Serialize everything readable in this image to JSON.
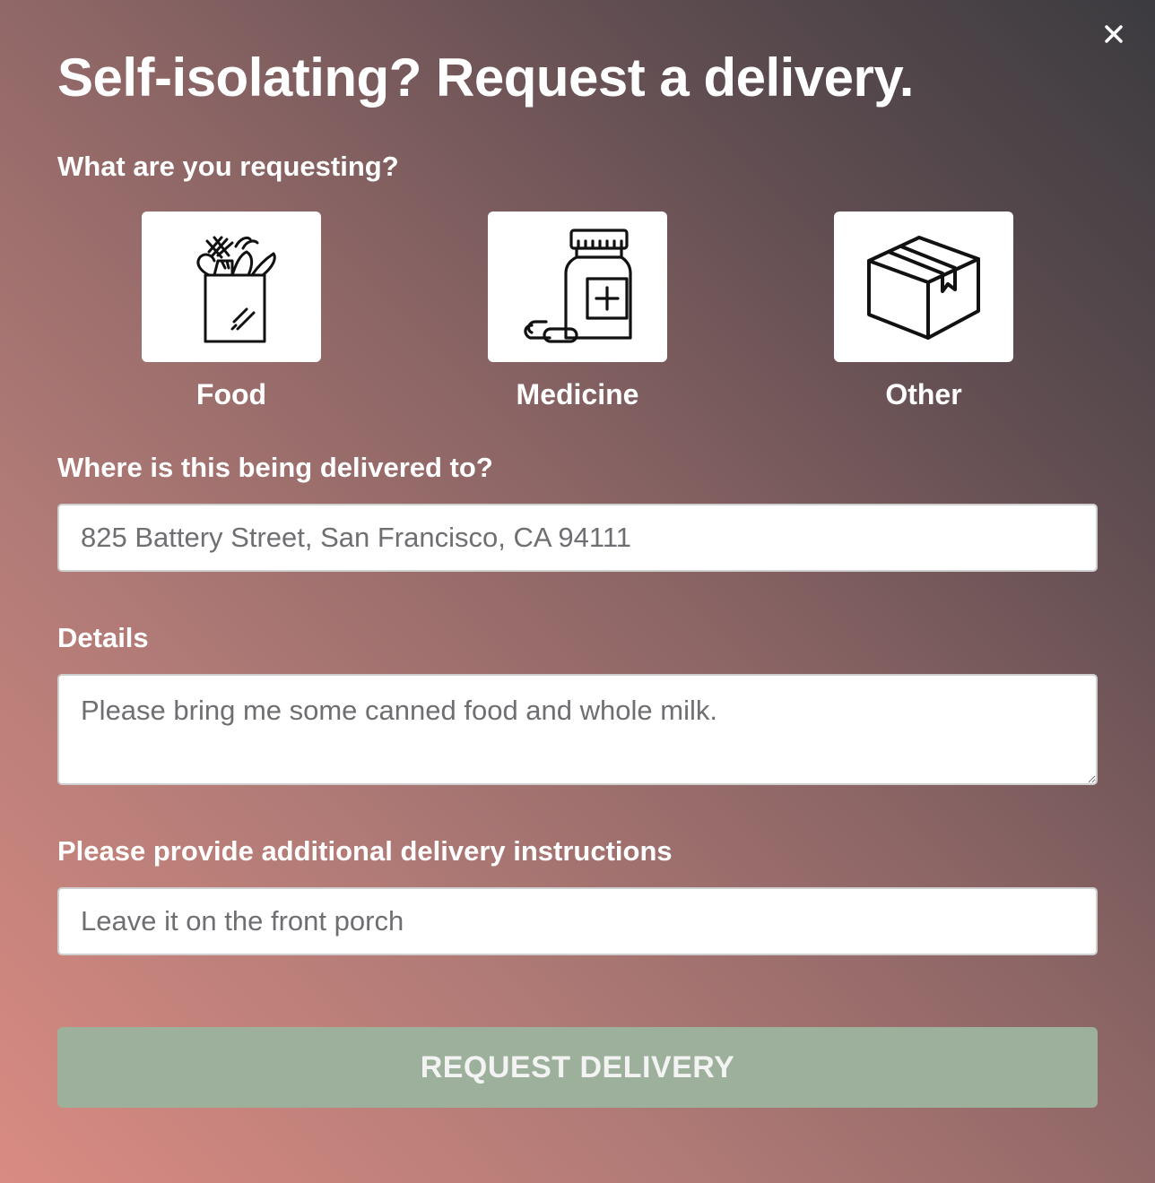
{
  "modal": {
    "title": "Self-isolating? Request a delivery.",
    "close_icon": "close-icon"
  },
  "request_type": {
    "label": "What are you requesting?",
    "options": [
      {
        "label": "Food",
        "icon": "grocery-bag-icon"
      },
      {
        "label": "Medicine",
        "icon": "medicine-bottle-icon"
      },
      {
        "label": "Other",
        "icon": "package-box-icon"
      }
    ]
  },
  "address": {
    "label": "Where is this being delivered to?",
    "placeholder": "825 Battery Street, San Francisco, CA 94111"
  },
  "details": {
    "label": "Details",
    "placeholder": "Please bring me some canned food and whole milk."
  },
  "instructions": {
    "label": "Please provide additional delivery instructions",
    "placeholder": "Leave it on the front porch"
  },
  "submit": {
    "label": "REQUEST DELIVERY",
    "color": "#9db09b"
  }
}
